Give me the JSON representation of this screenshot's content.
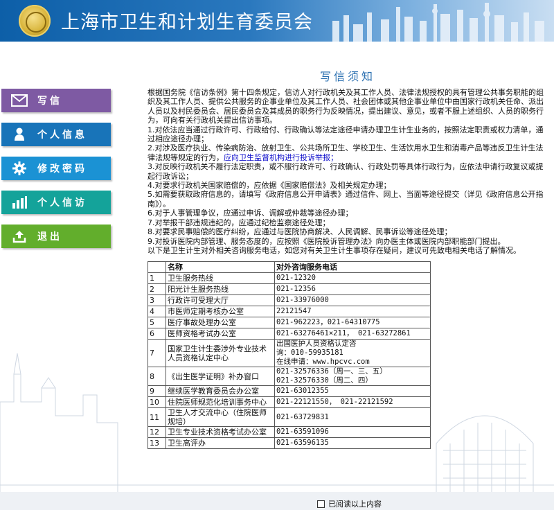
{
  "header": {
    "site_title": "上海市卫生和计划生育委员会"
  },
  "page": {
    "title": "写信须知"
  },
  "nav": [
    {
      "label": "写信",
      "icon": "mail-icon"
    },
    {
      "label": "个人信息",
      "icon": "person-icon"
    },
    {
      "label": "修改密码",
      "icon": "gear-icon"
    },
    {
      "label": "个人信访",
      "icon": "bar-chart-icon"
    },
    {
      "label": "退出",
      "icon": "upload-icon"
    }
  ],
  "notice": {
    "intro": "根据国务院《信访条例》第十四条规定，信访人对行政机关及其工作人员、法律法规授权的具有管理公共事务职能的组织及其工作人员、提供公共服务的企事业单位及其工作人员、社会团体或其他企事业单位中由国家行政机关任命、派出人员以及村民委员会、居民委员会及其成员的职务行为反映情况，提出建议、意见，或者不服上述组织、人员的职务行为，可向有关行政机关提出信访事项。",
    "items": [
      "1.对依法应当通过行政许可、行政给付、行政确认等法定途径申请办理卫生计生业务的，按照法定职责或权力清单，通过相应途径办理；",
      "2.对涉及医疗执业、传染病防治、放射卫生、公共场所卫生、学校卫生、生活饮用水卫生和消毒产品等违反卫生计生法律法规等规定的行为，",
      "3.对反映行政机关不履行法定职责，或不服行政许可、行政确认、行政处罚等具体行政行为，应依法申请行政复议或提起行政诉讼；",
      "4.对要求行政机关国家赔偿的，应依据《国家赔偿法》及相关规定办理；",
      "5.如需要获取政府信息的，请填写《政府信息公开申请表》通过信件、网上、当面等途径提交（详见《政府信息公开指南》）。",
      "6.对于人事管理争议，应通过申诉、调解或仲裁等途径办理；",
      "7.对举报干部违规违纪的，应通过纪检监察途径处理；",
      "8.对要求民事赔偿的医疗纠纷，应通过与医院协商解决、人民调解、民事诉讼等途径处理；",
      "9.对投诉医院内部管理、服务态度的，应按照《医院投诉管理办法》向办医主体或医院内部职能部门提出。"
    ],
    "item2_link": "应向卫生监督机构进行投诉举报；",
    "outro": "以下是卫生计生对外相关咨询服务电话，如您对有关卫生计生事项存在疑问，建议可先致电相关电话了解情况。"
  },
  "table": {
    "headers": [
      "",
      "名称",
      "对外咨询服务电话"
    ],
    "rows": [
      {
        "no": "1",
        "name": "卫生服务热线",
        "phone": [
          "021-12320"
        ]
      },
      {
        "no": "2",
        "name": "阳光计生服务热线",
        "phone": [
          "021-12356"
        ]
      },
      {
        "no": "3",
        "name": "行政许可受理大厅",
        "phone": [
          "021-33976000"
        ]
      },
      {
        "no": "4",
        "name": "市医师定期考核办公室",
        "phone": [
          "22121547"
        ]
      },
      {
        "no": "5",
        "name": "医疗事故处理办公室",
        "phone": [
          "021-962223，021-64310775"
        ]
      },
      {
        "no": "6",
        "name": "医师资格考试办公室",
        "phone": [
          "021-63276461×211， 021-63272861"
        ]
      },
      {
        "no": "7",
        "name": "国家卫生计生委涉外专业技术人员资格认定中心",
        "phone": [
          "出国医护人员资格认定咨",
          "询：010-59935181",
          "在线申请：www.hpcvc.com"
        ]
      },
      {
        "no": "8",
        "name": "《出生医学证明》补办窗口",
        "phone": [
          "021-32576336（周一、三、五）",
          "021-32576330（周二、四）"
        ]
      },
      {
        "no": "9",
        "name": "继续医学教育委员会办公室",
        "phone": [
          "021-63012355"
        ]
      },
      {
        "no": "10",
        "name": "住院医师规范化培训事务中心",
        "phone": [
          "021-22121550， 021-22121592"
        ]
      },
      {
        "no": "11",
        "name": "卫生人才交流中心（住院医师规培）",
        "phone": [
          "021-63729831"
        ]
      },
      {
        "no": "12",
        "name": "卫生专业技术资格考试办公室",
        "phone": [
          "021-63591096"
        ]
      },
      {
        "no": "13",
        "name": "卫生高评办",
        "phone": [
          "021-63596135"
        ]
      }
    ]
  },
  "agree": {
    "label": "已阅读以上内容",
    "checked": false
  }
}
